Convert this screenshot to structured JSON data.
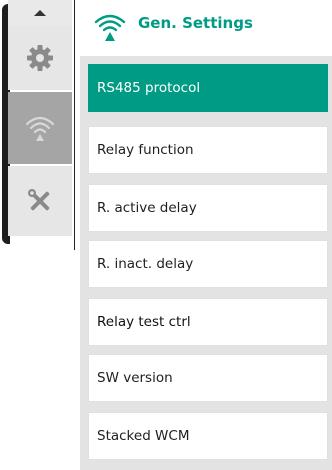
{
  "header": {
    "title": "Gen. Settings",
    "icon": "wifi-signal-icon"
  },
  "rail": {
    "items": [
      {
        "icon": "chevron-up-icon"
      },
      {
        "icon": "gear-icon"
      },
      {
        "icon": "wifi-signal-icon",
        "selected": true
      },
      {
        "icon": "tools-icon"
      }
    ]
  },
  "menu": {
    "items": [
      {
        "label": "RS485 protocol",
        "selected": true
      },
      {
        "label": "Relay function"
      },
      {
        "label": "R. active delay"
      },
      {
        "label": "R. inact. delay"
      },
      {
        "label": "Relay test ctrl"
      },
      {
        "label": "SW version"
      },
      {
        "label": "Stacked WCM"
      }
    ]
  },
  "colors": {
    "accent": "#009b84",
    "rail_bg": "#e6e6e6",
    "rail_selected": "#a5a5a5",
    "list_bg": "#e3e3e3"
  }
}
